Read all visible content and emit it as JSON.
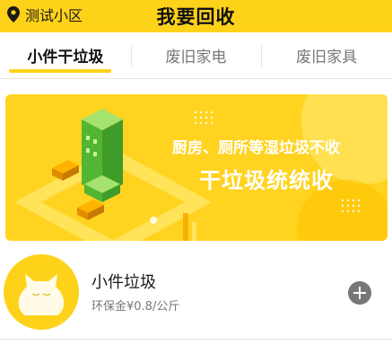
{
  "header": {
    "location": "测试小区",
    "location_icon": "location-pin-icon",
    "title": "我要回收"
  },
  "tabs": [
    {
      "label": "小件干垃圾",
      "active": true
    },
    {
      "label": "废旧家电",
      "active": false
    },
    {
      "label": "废旧家具",
      "active": false
    }
  ],
  "banner": {
    "line1": "厨房、厕所等湿垃圾不收",
    "line2": "干垃圾统统收"
  },
  "items": [
    {
      "name": "小件垃圾",
      "price": "环保金¥0.8/公斤",
      "thumb_icon": "garbage-bag-icon",
      "action_icon": "plus-circle-icon"
    }
  ],
  "colors": {
    "accent": "#ffd21a",
    "building": "#5cc33a",
    "muted": "#777777"
  }
}
